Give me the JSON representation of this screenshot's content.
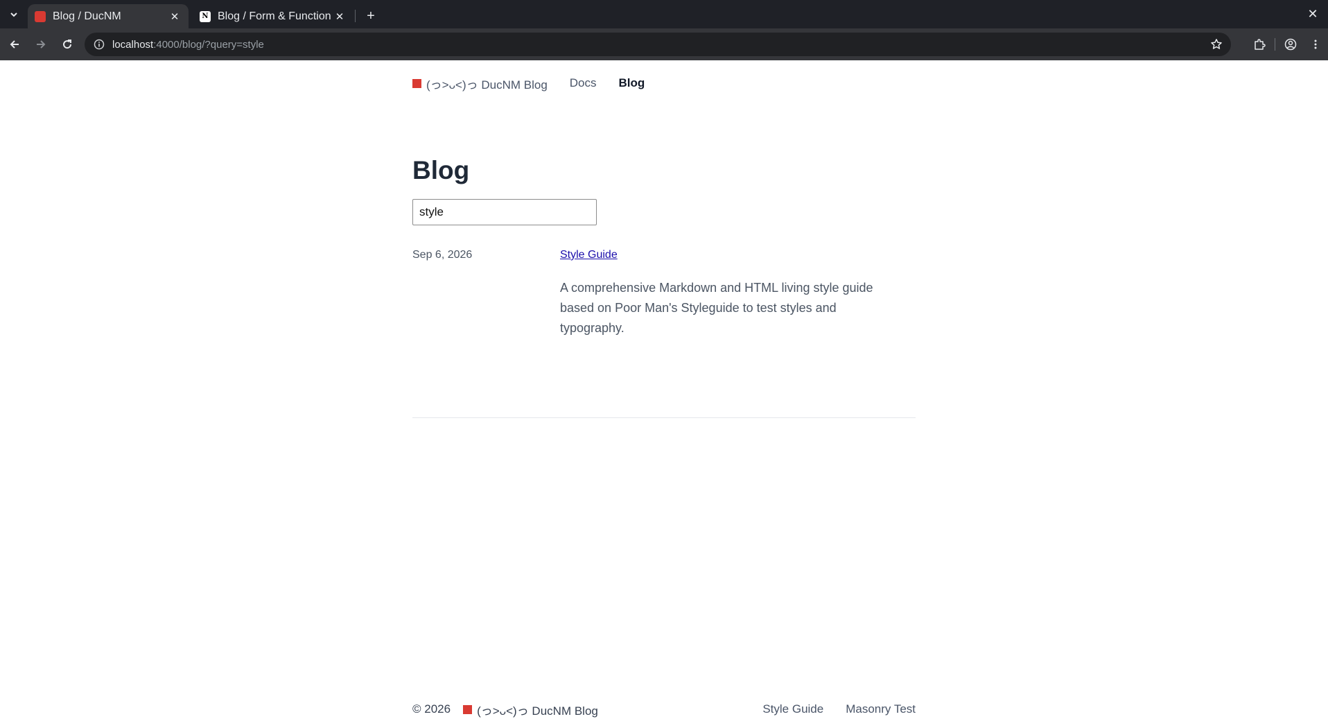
{
  "browser": {
    "tabs": [
      {
        "title": "Blog / DucNM",
        "active": true,
        "favicon": "red-square"
      },
      {
        "title": "Blog / Form & Function",
        "active": false,
        "favicon": "notion-n",
        "favicon_letter": "N"
      }
    ],
    "url_host": "localhost",
    "url_path": ":4000/blog/?query=style"
  },
  "site": {
    "brand": "(っ˃ᴗ˂)っ DucNM Blog",
    "nav": [
      {
        "label": "Docs",
        "current": false
      },
      {
        "label": "Blog",
        "current": true
      }
    ]
  },
  "main": {
    "title": "Blog",
    "search_value": "style",
    "posts": [
      {
        "date": "Sep 6, 2026",
        "title": "Style Guide",
        "description": "A comprehensive Markdown and HTML living style guide based on Poor Man's Styleguide to test styles and typography."
      }
    ]
  },
  "footer": {
    "copyright": "© 2026",
    "brand": "(っ˃ᴗ˂)っ DucNM Blog",
    "links": [
      "Style Guide",
      "Masonry Test"
    ]
  },
  "colors": {
    "brand_red": "#d93a32",
    "link": "#1a0dab",
    "chrome_dark": "#1f2127",
    "chrome_toolbar": "#35363a"
  }
}
